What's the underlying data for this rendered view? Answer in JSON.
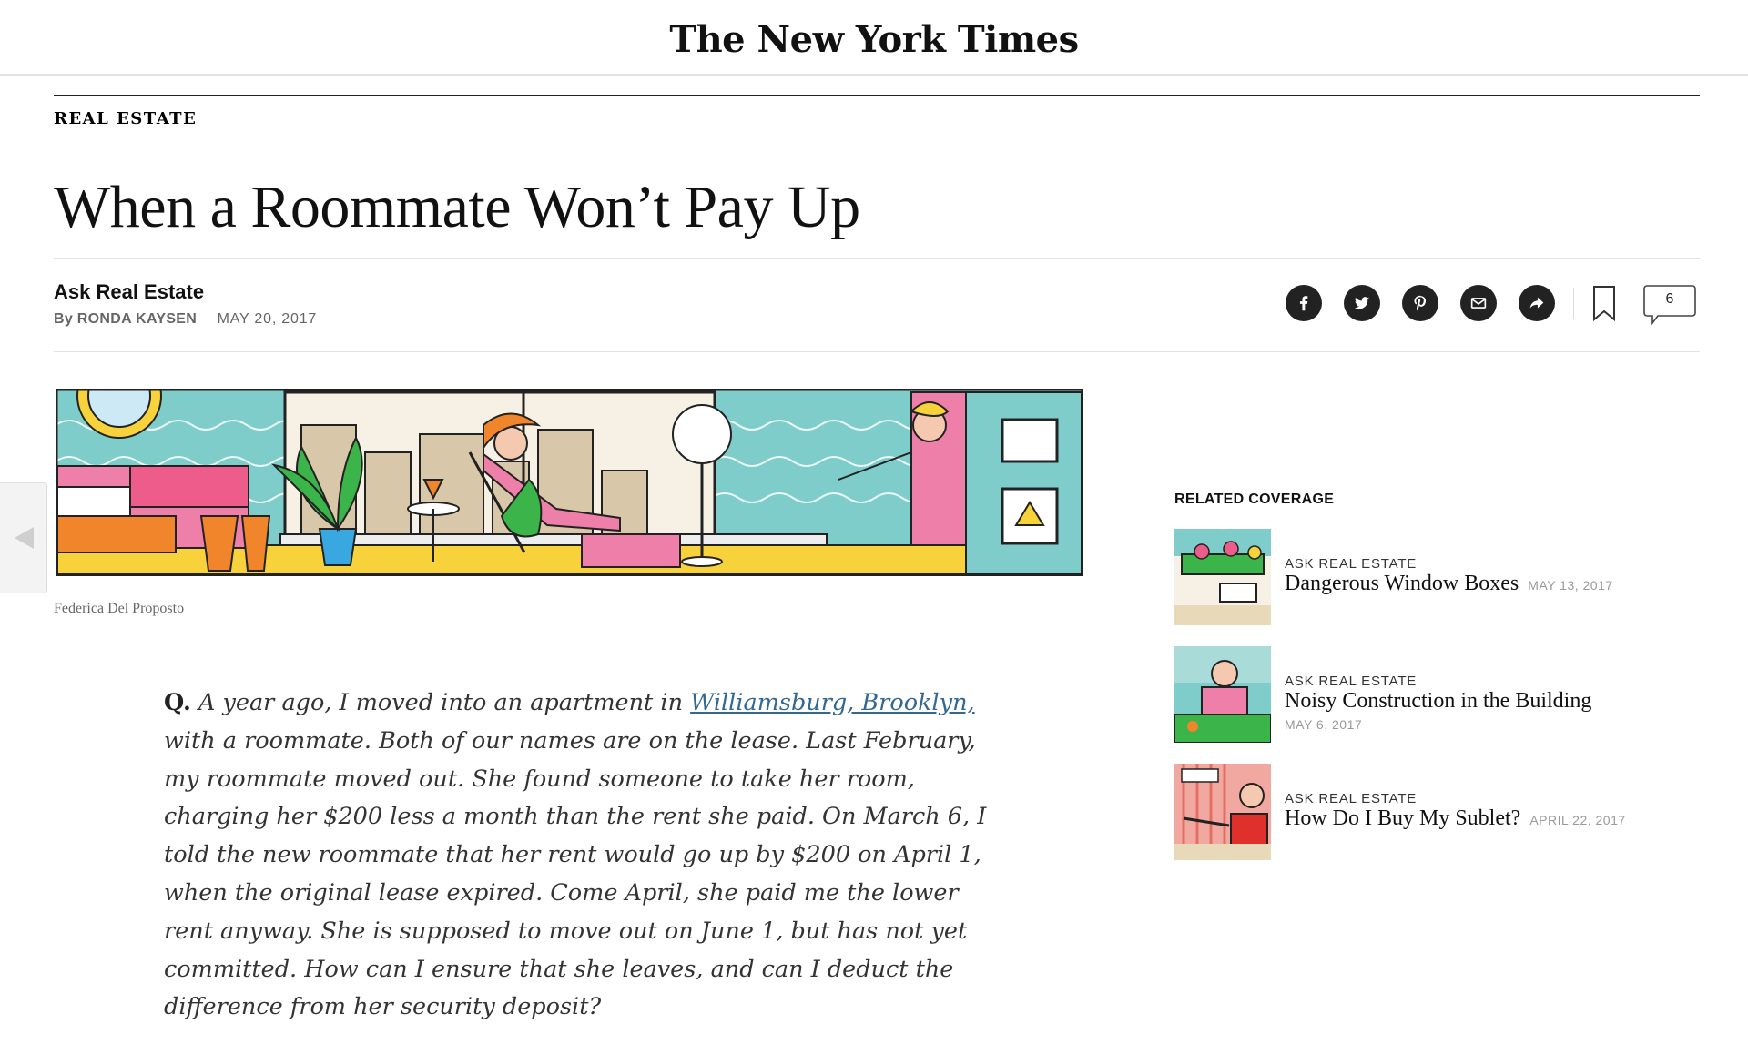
{
  "masthead": {
    "logo_text": "The New York Times"
  },
  "article": {
    "section": "REAL ESTATE",
    "headline": "When a Roommate Won’t Pay Up",
    "column": "Ask Real Estate",
    "byline": "By RONDA KAYSEN",
    "date": "MAY 20, 2017",
    "image_credit": "Federica Del Proposto",
    "body": {
      "q_label": "Q.",
      "text_before_link": "A year ago, I moved into an apartment in",
      "link_text": "Williamsburg, Brooklyn,",
      "text_after_link": "with a roommate. Both of our names are on the lease. Last February, my roommate moved out. She found someone to take her room, charging her $200 less a month than the rent she paid. On March 6, I told the new roommate that her rent would go up by $200 on April 1, when the original lease expired. Come April, she paid me the lower rent anyway. She is supposed to move out on June 1, but has not yet committed. How can I ensure that she leaves, and can I deduct the difference from her security deposit?"
    }
  },
  "share_tools": {
    "buttons": [
      {
        "name": "facebook",
        "icon": "facebook-icon"
      },
      {
        "name": "twitter",
        "icon": "twitter-icon"
      },
      {
        "name": "pinterest",
        "icon": "pinterest-icon"
      },
      {
        "name": "email",
        "icon": "email-icon"
      },
      {
        "name": "more",
        "icon": "share-arrow-icon"
      }
    ],
    "bookmark_icon": "bookmark-icon",
    "comment_count": "6"
  },
  "related": {
    "title": "RELATED COVERAGE",
    "items": [
      {
        "kicker": "ASK REAL ESTATE",
        "headline": "Dangerous Window Boxes",
        "date": "MAY 13, 2017"
      },
      {
        "kicker": "ASK REAL ESTATE",
        "headline": "Noisy Construction in the Building",
        "date": "MAY 6, 2017"
      },
      {
        "kicker": "ASK REAL ESTATE",
        "headline": "How Do I Buy My Sublet?",
        "date": "APRIL 22, 2017"
      }
    ]
  },
  "colors": {
    "link": "#326891",
    "illustration_teal": "#7fcdcb",
    "illustration_pink": "#ee7fa8",
    "illustration_yellow": "#f7d23b",
    "illustration_orange": "#f0852c",
    "illustration_green": "#3bb54a"
  }
}
